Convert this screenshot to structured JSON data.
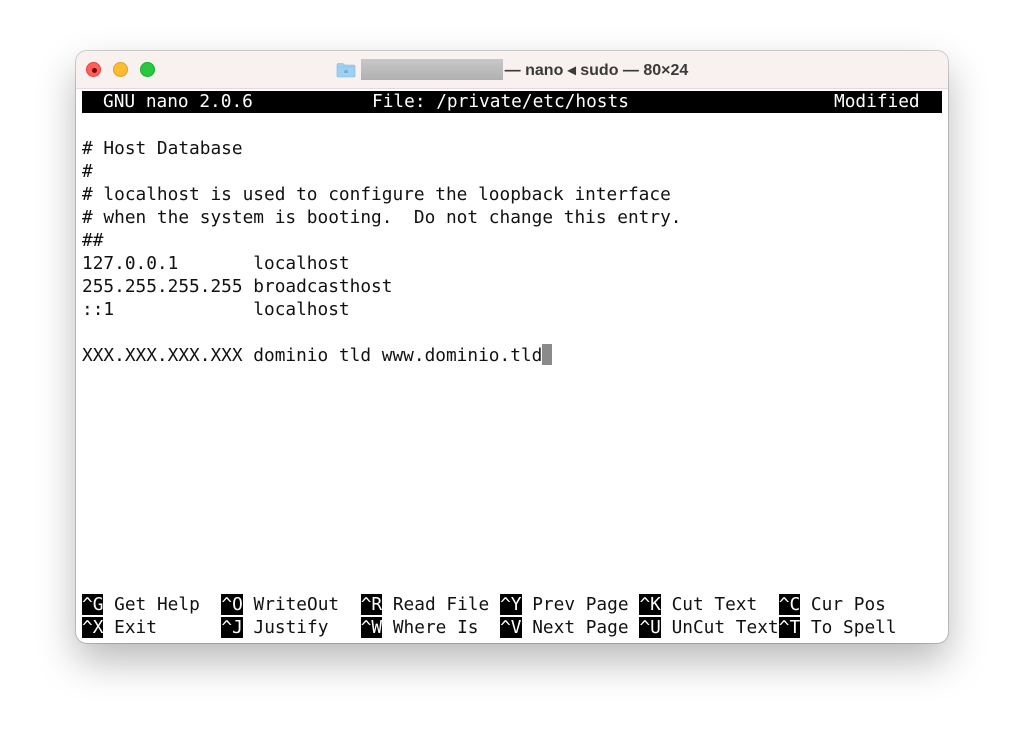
{
  "window": {
    "title_suffix": "— nano ◂ sudo — 80×24",
    "folder_icon": "home-folder-icon",
    "redacted_path": ""
  },
  "nano": {
    "header": {
      "app": "GNU nano 2.0.6",
      "file": "File: /private/etc/hosts",
      "status": "Modified"
    },
    "lines": [
      "# Host Database",
      "#",
      "# localhost is used to configure the loopback interface",
      "# when the system is booting.  Do not change this entry.",
      "##",
      "127.0.0.1       localhost",
      "255.255.255.255 broadcasthost",
      "::1             localhost",
      "",
      "XXX.XXX.XXX.XXX dominio tld www.dominio.tld"
    ],
    "cursor_line": 9,
    "shortcuts": [
      {
        "key": "^G",
        "label": "Get Help"
      },
      {
        "key": "^O",
        "label": "WriteOut"
      },
      {
        "key": "^R",
        "label": "Read File"
      },
      {
        "key": "^Y",
        "label": "Prev Page"
      },
      {
        "key": "^K",
        "label": "Cut Text"
      },
      {
        "key": "^C",
        "label": "Cur Pos"
      },
      {
        "key": "^X",
        "label": "Exit"
      },
      {
        "key": "^J",
        "label": "Justify"
      },
      {
        "key": "^W",
        "label": "Where Is"
      },
      {
        "key": "^V",
        "label": "Next Page"
      },
      {
        "key": "^U",
        "label": "UnCut Text"
      },
      {
        "key": "^T",
        "label": "To Spell"
      }
    ]
  }
}
